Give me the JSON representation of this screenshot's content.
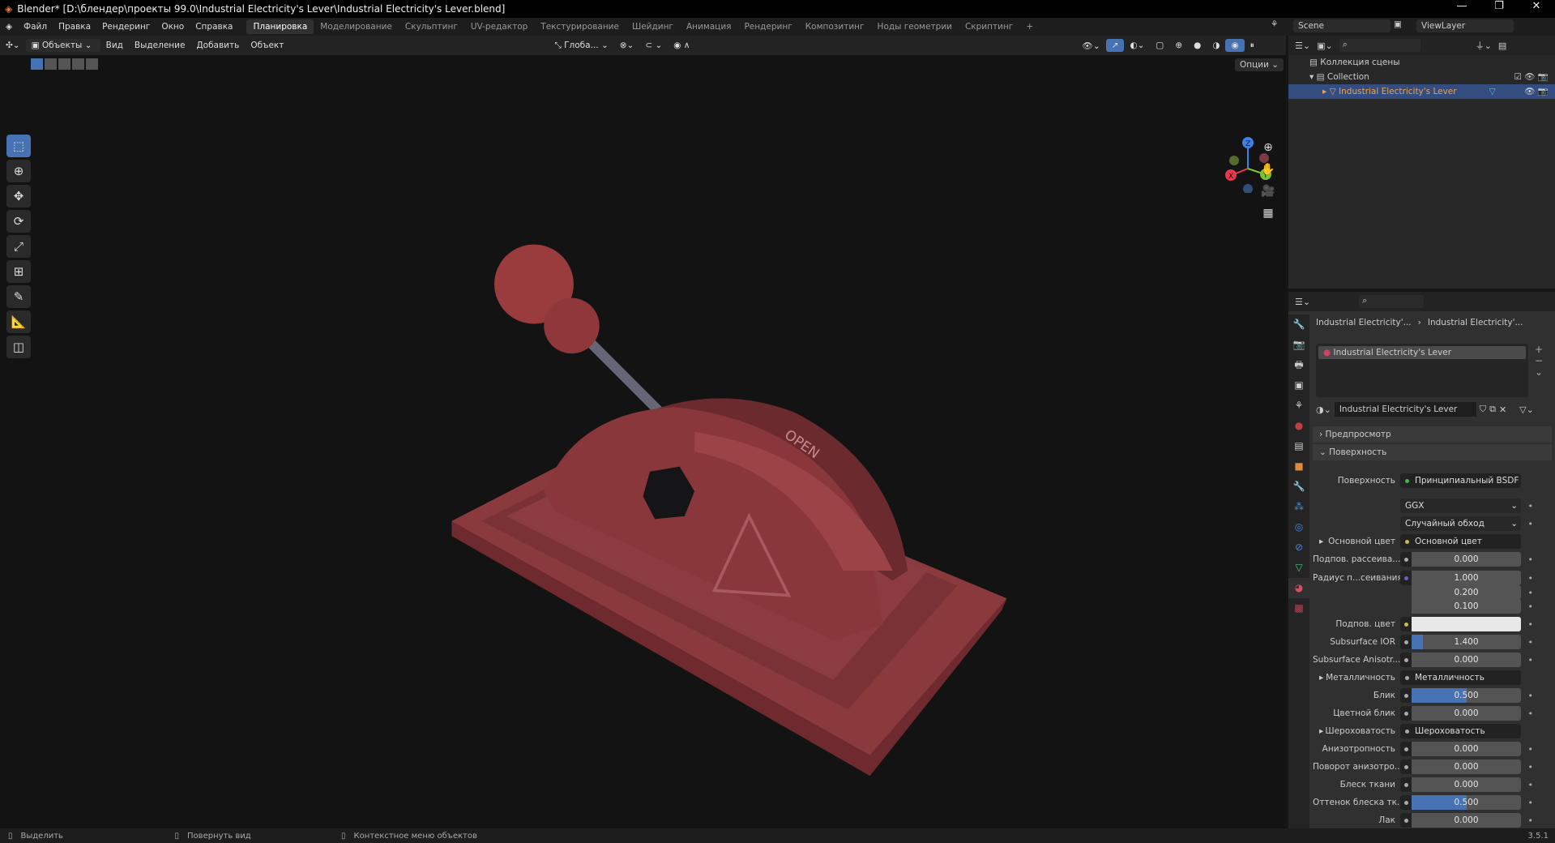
{
  "window": {
    "title": "Blender* [D:\\блендер\\проекты 99.0\\Industrial Electricity's Lever\\Industrial Electricity's Lever.blend]"
  },
  "menu": [
    "Файл",
    "Правка",
    "Рендеринг",
    "Окно",
    "Справка"
  ],
  "workspaces": [
    "Планировка",
    "Моделирование",
    "Скульптинг",
    "UV-редактор",
    "Текстурирование",
    "Шейдинг",
    "Анимация",
    "Рендеринг",
    "Композитинг",
    "Ноды геометрии",
    "Скриптинг",
    "+"
  ],
  "scene": {
    "scene": "Scene",
    "view_layer": "ViewLayer"
  },
  "header": {
    "mode": "Объекты",
    "view": "Вид",
    "select": "Выделение",
    "add": "Добавить",
    "object": "Объект",
    "orientation": "Глоба...",
    "options": "Опции"
  },
  "gizmo": {
    "x": "X",
    "y": "Y",
    "z": "Z"
  },
  "outliner": {
    "root": "Коллекция сцены",
    "collection": "Collection",
    "object": "Industrial Electricity's Lever"
  },
  "props": {
    "crumb1": "Industrial Electricity'...",
    "crumb2": "Industrial Electricity'...",
    "slot": "Industrial Electricity's Lever",
    "material": "Industrial Electricity's Lever",
    "preview": "Предпросмотр",
    "surface_panel": "Поверхность",
    "rows": [
      {
        "label": "Поверхность",
        "link": "Принципиальный BSDF",
        "sock": "#4caf50"
      },
      {
        "label": "",
        "dropdown": "GGX"
      },
      {
        "label": "",
        "dropdown": "Случайный обход"
      },
      {
        "label": "Основной цвет",
        "link": "Основной цвет",
        "sock": "#c8c040",
        "expand": true
      },
      {
        "label": "Подпов. рассеива...",
        "value": "0.000",
        "fill": 0
      },
      {
        "label": "Радиус п...сеивания",
        "value": "1.000",
        "fill": 0,
        "sock": "#6363c7"
      },
      {
        "label": "",
        "value": "0.200",
        "fill": 0
      },
      {
        "label": "",
        "value": "0.100",
        "fill": 0
      },
      {
        "label": "Подпов. цвет",
        "color": "#e8e8e8",
        "sock": "#c8c040"
      },
      {
        "label": "Subsurface IOR",
        "value": "1.400",
        "fill": 0.1
      },
      {
        "label": "Subsurface Anisotr...",
        "value": "0.000",
        "fill": 0
      },
      {
        "label": "Металличность",
        "link": "Металличность",
        "sock": "#aaaaaa",
        "expand": true
      },
      {
        "label": "Блик",
        "value": "0.500",
        "fill": 0.5
      },
      {
        "label": "Цветной блик",
        "value": "0.000",
        "fill": 0
      },
      {
        "label": "Шероховатость",
        "link": "Шероховатость",
        "sock": "#aaaaaa",
        "expand": true
      },
      {
        "label": "Анизотропность",
        "value": "0.000",
        "fill": 0
      },
      {
        "label": "Поворот анизотро...",
        "value": "0.000",
        "fill": 0
      },
      {
        "label": "Блеск ткани",
        "value": "0.000",
        "fill": 0
      },
      {
        "label": "Оттенок блеска тк...",
        "value": "0.500",
        "fill": 0.5
      },
      {
        "label": "Лак",
        "value": "0.000",
        "fill": 0
      }
    ]
  },
  "viewport_text": {
    "decal": "OPEN"
  },
  "status": {
    "select": "Выделить",
    "rotate": "Повернуть вид",
    "context": "Контекстное меню объектов",
    "version": "3.5.1"
  }
}
